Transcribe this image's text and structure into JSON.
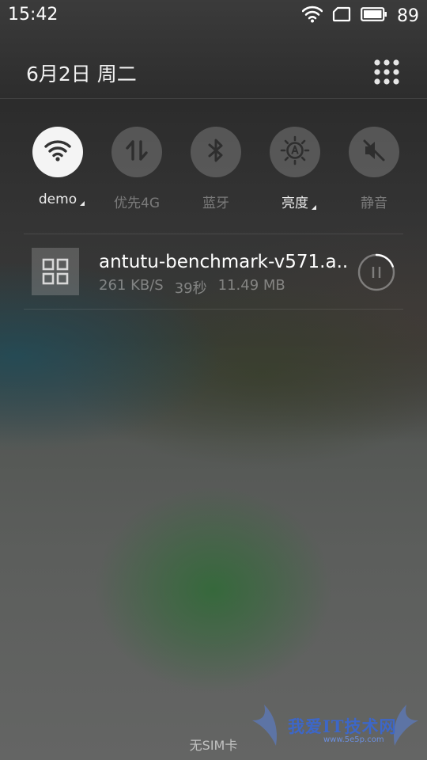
{
  "status_bar": {
    "time": "15:42",
    "battery_level": "89",
    "icons": [
      "wifi-icon",
      "sim-icon",
      "battery-icon"
    ]
  },
  "header": {
    "date": "6月2日  周二",
    "menu_icon": "grid-icon"
  },
  "quick_toggles": [
    {
      "id": "wifi",
      "label": "demo",
      "icon": "wifi-icon",
      "active": true,
      "expandable": true
    },
    {
      "id": "mobile-data",
      "label": "优先4G",
      "icon": "data-transfer-icon",
      "active": false,
      "expandable": false
    },
    {
      "id": "bluetooth",
      "label": "蓝牙",
      "icon": "bluetooth-icon",
      "active": false,
      "expandable": false
    },
    {
      "id": "brightness",
      "label": "亮度",
      "icon": "brightness-icon",
      "active": false,
      "expandable": true
    },
    {
      "id": "mute",
      "label": "静音",
      "icon": "mute-icon",
      "active": false,
      "expandable": false
    }
  ],
  "notification": {
    "title": "antutu-benchmark-v571.a..",
    "speed": "261 KB/S",
    "remaining": "39秒",
    "size": "11.49 MB",
    "app_icon": "app-grid-icon",
    "action_icon": "pause-icon"
  },
  "footer": {
    "sim_status": "无SIM卡"
  },
  "watermark": {
    "text": "我爱IT技术网",
    "url": "www.5e5p.com"
  },
  "colors": {
    "active_toggle": "#f4f4f4",
    "inactive_toggle": "#6e6e6e",
    "watermark": "#3d67c8"
  }
}
